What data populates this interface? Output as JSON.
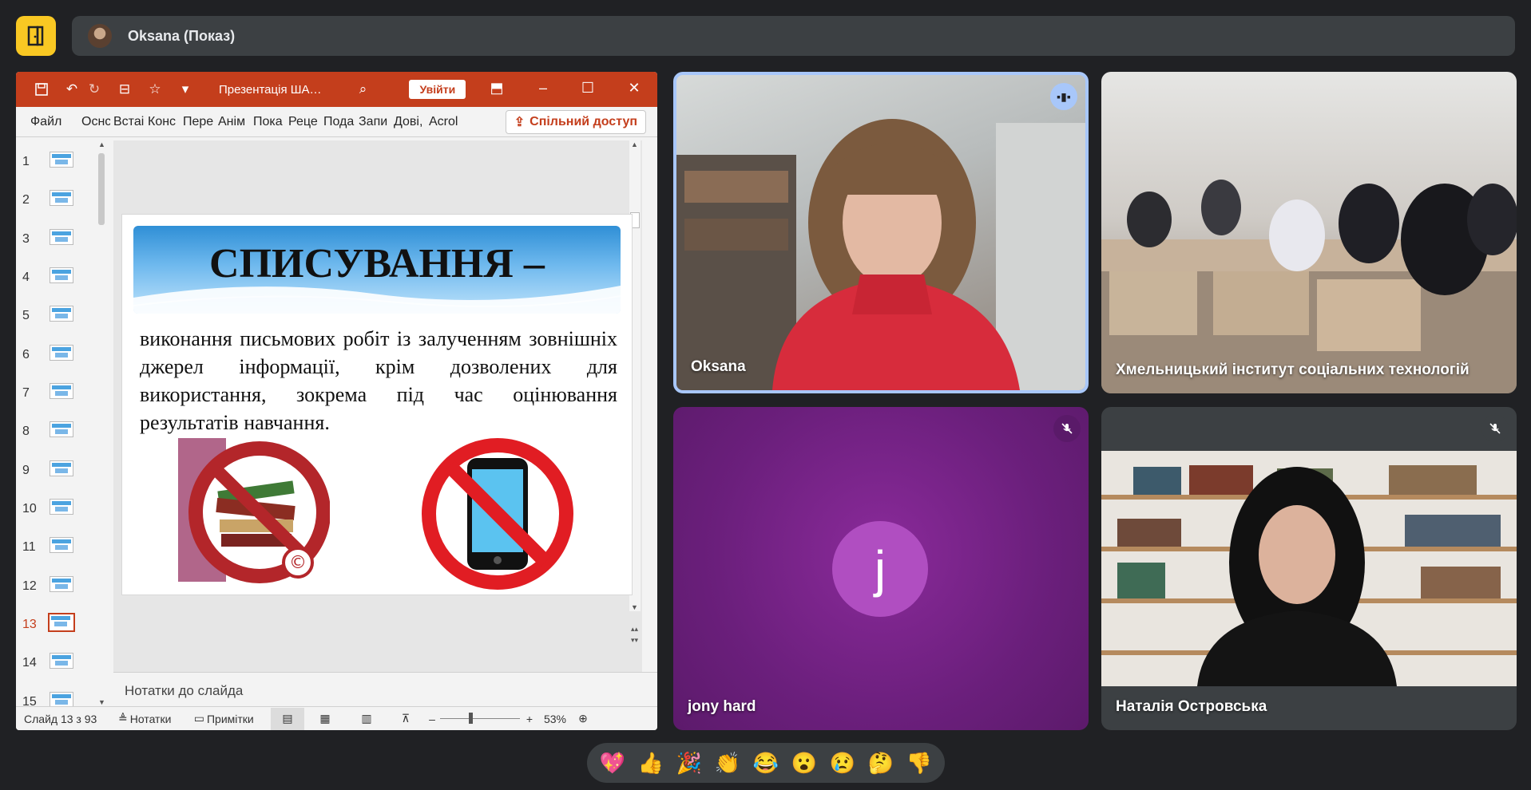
{
  "presenter": {
    "name": "Oksana (Показ)"
  },
  "ppt": {
    "doc_title": "Презентація ША…",
    "login_label": "Увійти",
    "ribbon_tabs": [
      "Файл",
      "Оснс",
      "Встаі",
      "Конс",
      "Пере",
      "Анім",
      "Пока",
      "Реце",
      "Пода",
      "Запи",
      "Дові,",
      "Acrol"
    ],
    "share_label": "Спільний доступ",
    "slide_numbers": [
      "1",
      "2",
      "3",
      "4",
      "5",
      "6",
      "7",
      "8",
      "9",
      "10",
      "11",
      "12",
      "13",
      "14",
      "15"
    ],
    "current_slide": "13",
    "slide": {
      "title": "СПИСУВАННЯ –",
      "body": "виконання письмових робіт із залученням зовнішніх джерел інформації, крім дозволених для використання, зокрема під час оцінювання результатів навчання."
    },
    "notes_placeholder": "Нотатки до слайда",
    "status": {
      "slide_counter": "Слайд 13 з 93",
      "notes_label": "Нотатки",
      "comments_label": "Примітки",
      "zoom": "53%"
    }
  },
  "tiles": {
    "oksana": {
      "name": "Oksana"
    },
    "room": {
      "name": "Хмельницький інститут соціальних технологій"
    },
    "jony": {
      "name": "jony hard",
      "initial": "j"
    },
    "natalia": {
      "name": "Наталія Островська"
    }
  },
  "reactions": [
    "💖",
    "👍",
    "🎉",
    "👏",
    "😂",
    "😮",
    "😢",
    "🤔",
    "👎"
  ],
  "colors": {
    "ppt_brand": "#c43e1c",
    "active_speaker_border": "#a8c7fa",
    "logo_yellow": "#f9c823"
  }
}
